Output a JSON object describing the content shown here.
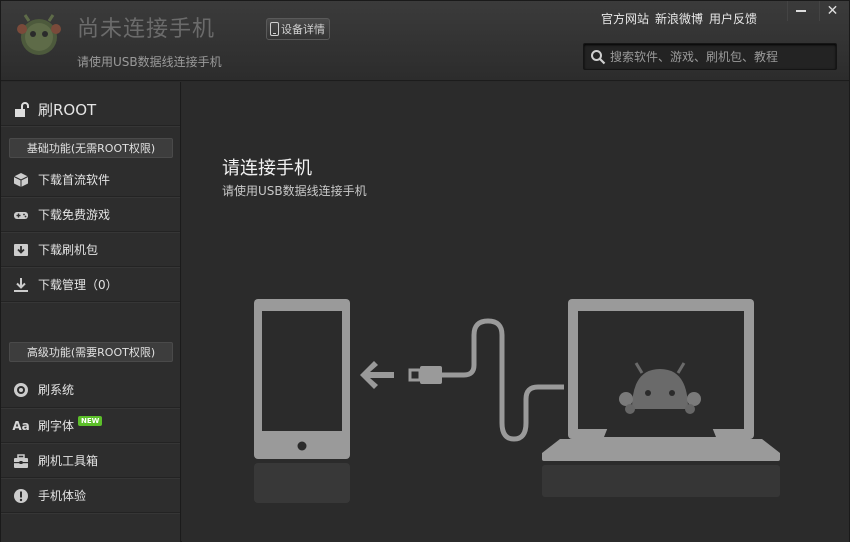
{
  "header": {
    "title": "尚未连接手机",
    "subtitle": "请使用USB数据线连接手机",
    "device_button": "设备详情",
    "links": [
      "官方网站",
      "新浪微博",
      "用户反馈"
    ],
    "minimize": "",
    "close": "✕"
  },
  "search": {
    "placeholder": "搜索软件、游戏、刷机包、教程",
    "value": ""
  },
  "sidebar": {
    "root": "刷ROOT",
    "basic_section": "基础功能(无需ROOT权限)",
    "basic_items": [
      "下载首流软件",
      "下载免费游戏",
      "下载刷机包",
      "下载管理（0）"
    ],
    "advanced_section": "高级功能(需要ROOT权限)",
    "advanced_items": [
      "刷系统",
      "刷字体",
      "刷机工具箱",
      "手机体验"
    ],
    "new_badge": "NEW"
  },
  "main": {
    "title": "请连接手机",
    "subtitle": "请使用USB数据线连接手机"
  },
  "colors": {
    "accent_new": "#5cbf2a",
    "illustration_grey": "#9a9a9a"
  }
}
